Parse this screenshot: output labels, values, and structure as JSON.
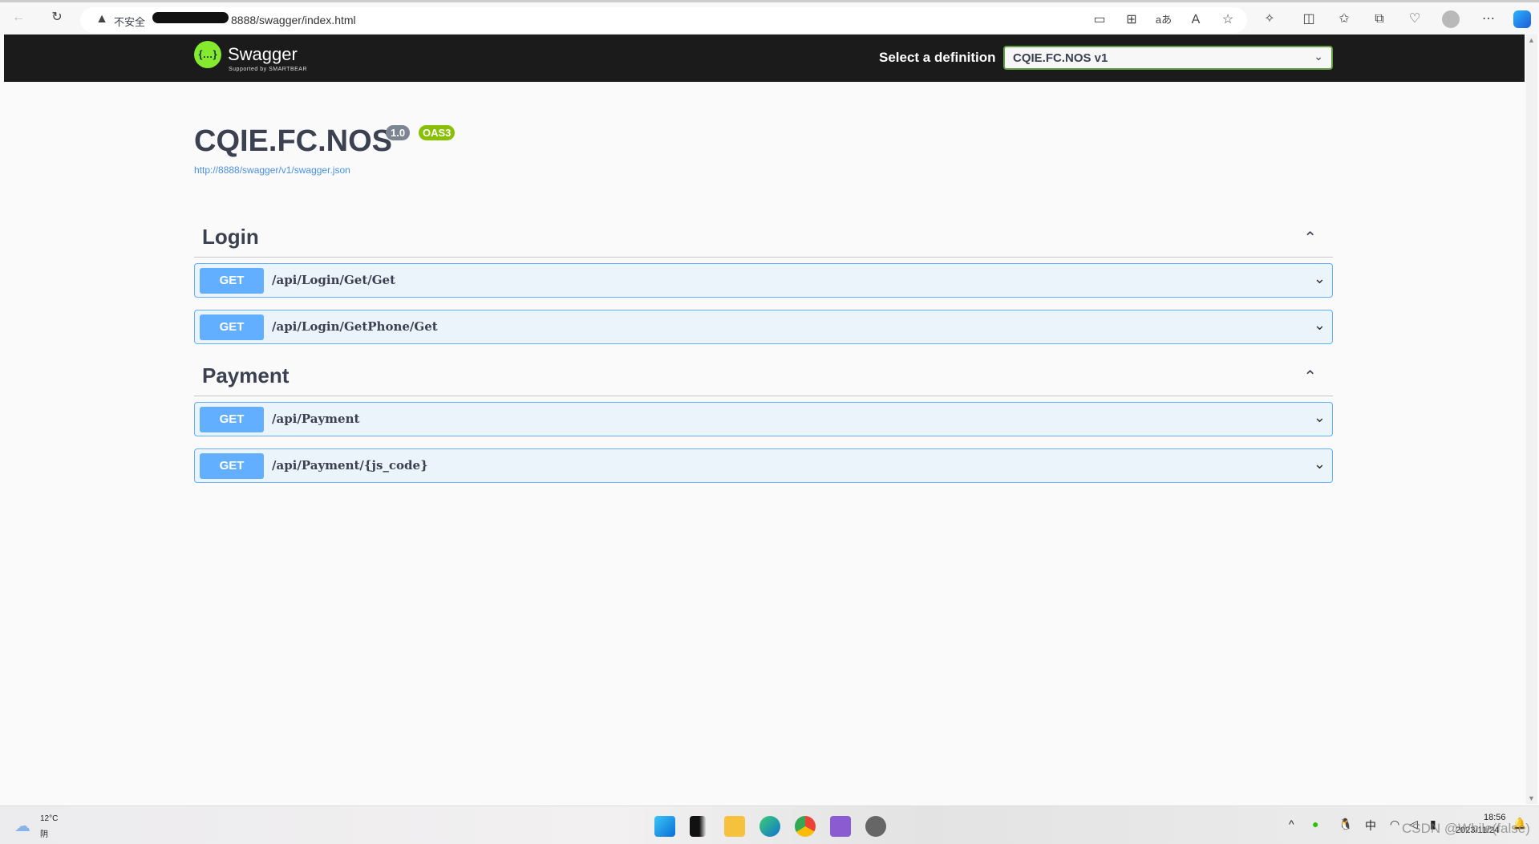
{
  "browser": {
    "security": "不安全",
    "url": "8888/swagger/index.html",
    "icons": [
      "back-icon",
      "refresh-icon",
      "warning-icon",
      "device-icon",
      "apps-icon",
      "translate-icon",
      "read-aloud-icon",
      "favorite-icon",
      "extensions-icon",
      "split-screen-icon",
      "favorites-icon",
      "collections-icon",
      "health-icon",
      "profile-icon",
      "more-icon",
      "copilot-icon"
    ]
  },
  "header": {
    "logo_text": "Swagger",
    "logo_sub": "Supported by SMARTBEAR",
    "select_label": "Select a definition",
    "select_value": "CQIE.FC.NOS v1"
  },
  "info": {
    "title": "CQIE.FC.NOS",
    "version": "1.0",
    "oas": "OAS3",
    "link": "http://8888/swagger/v1/swagger.json"
  },
  "sections": [
    {
      "name": "Login",
      "ops": [
        {
          "method": "GET",
          "path": "/api/Login/Get/Get"
        },
        {
          "method": "GET",
          "path": "/api/Login/GetPhone/Get"
        }
      ]
    },
    {
      "name": "Payment",
      "ops": [
        {
          "method": "GET",
          "path": "/api/Payment"
        },
        {
          "method": "GET",
          "path": "/api/Payment/{js_code}"
        }
      ]
    }
  ],
  "taskbar": {
    "temp": "12°C",
    "weather": "阴",
    "ime": "中",
    "time": "18:56",
    "date": "2023/11/24",
    "watermark": "CSDN @While(false)"
  },
  "colors": {
    "get": "#61affe",
    "oas": "#89bf04",
    "header": "#1b1b1b"
  }
}
